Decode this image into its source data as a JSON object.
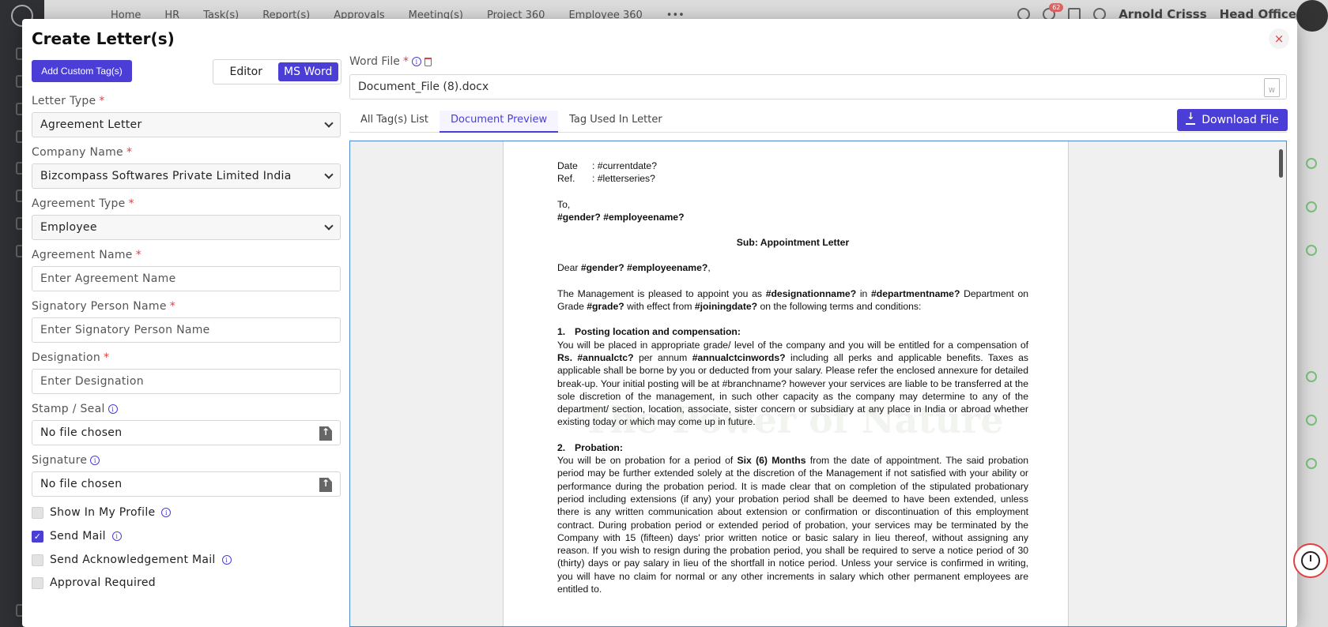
{
  "app": {
    "nav": [
      "Home",
      "HR",
      "Task(s)",
      "Report(s)",
      "Approvals",
      "Meeting(s)",
      "Project 360",
      "Employee 360"
    ],
    "notification_count": "62",
    "user_name": "Arnold Crisss",
    "branch": "Head Office"
  },
  "modal": {
    "title": "Create Letter(s)",
    "close": "×",
    "add_custom_tag": "Add Custom Tag(s)",
    "toggle": {
      "editor": "Editor",
      "ms_word": "MS Word"
    },
    "fields": {
      "letter_type": {
        "label": "Letter Type",
        "value": "Agreement Letter"
      },
      "company_name": {
        "label": "Company Name",
        "value": "Bizcompass Softwares Private Limited India"
      },
      "agreement_type": {
        "label": "Agreement Type",
        "value": "Employee"
      },
      "agreement_name": {
        "label": "Agreement Name",
        "placeholder": "Enter Agreement Name"
      },
      "signatory": {
        "label": "Signatory Person Name",
        "placeholder": "Enter Signatory Person Name"
      },
      "designation": {
        "label": "Designation",
        "placeholder": "Enter Designation"
      },
      "stamp": {
        "label": "Stamp / Seal",
        "value": "No file chosen"
      },
      "signature": {
        "label": "Signature",
        "value": "No file chosen"
      }
    },
    "checks": {
      "show_profile": "Show In My Profile",
      "send_mail": "Send Mail",
      "send_ack": "Send Acknowledgement Mail",
      "approval": "Approval Required"
    },
    "word_file": {
      "label": "Word File",
      "value": "Document_File (8).docx",
      "doc_icon": "W"
    },
    "tabs": [
      "All Tag(s) List",
      "Document Preview",
      "Tag Used In Letter"
    ],
    "download": "Download File"
  },
  "document": {
    "date_label": "Date",
    "date_value": ": #currentdate?",
    "ref_label": "Ref.",
    "ref_value": ": #letterseries?",
    "to": "To,",
    "addressee": "#gender? #employeename?",
    "subject": "Sub: Appointment Letter",
    "dear_pre": "Dear ",
    "dear_name": "#gender? #employeename?",
    "dear_post": ",",
    "intro_1": "The Management is pleased to appoint you as ",
    "intro_desig": "#designationname?",
    "intro_2": " in ",
    "intro_dept": "#departmentname?",
    "intro_3": " Department on Grade ",
    "intro_grade": "#grade?",
    "intro_4": " with effect from ",
    "intro_join": "#joiningdate?",
    "intro_5": " on the following terms and conditions:",
    "s1_num": "1.",
    "s1_title": "Posting location and compensation:",
    "s1_a": "You will be placed in appropriate grade/ level of the company and you will be entitled for a compensation of ",
    "s1_rs": "Rs. #annualctc?",
    "s1_b": " per annum ",
    "s1_words": "#annualctcinwords?",
    "s1_c": " including all perks and applicable benefits. Taxes as applicable shall be borne by you or deducted from your salary. Please refer the enclosed annexure for detailed break-up. Your initial posting will be at #branchname? however your services are liable to be transferred at the sole discretion of the management, in such other capacity as the company may determine to any of the department/ section, location, associate, sister concern or subsidiary at any place in India or abroad whether existing today or which may come up in future.",
    "s2_num": "2.",
    "s2_title": "Probation:",
    "s2_a": "You will be on probation for a period of ",
    "s2_period": "Six (6) Months",
    "s2_b": " from the date of appointment. The said probation period may be further extended solely at the discretion of the Management if not satisfied with your ability or performance during the probation period. It is made clear that on completion of the stipulated probationary period including extensions (if any) your probation period shall be deemed to have been extended, unless there is any written communication about extension or confirmation or discontinuation of this employment contract. During probation period or extended period of probation, your services may be terminated by the Company with 15 (fifteen) days' prior written notice or basic salary in lieu thereof, without assigning any reason. If you wish to resign during the probation period, you shall be required to serve a notice period of 30 (thirty) days or pay salary in lieu of the shortfall in notice period. Unless your service is confirmed in writing, you will have no claim for normal or any other increments in salary which other permanent employees are entitled to.",
    "watermark": "The Power of Nature"
  }
}
